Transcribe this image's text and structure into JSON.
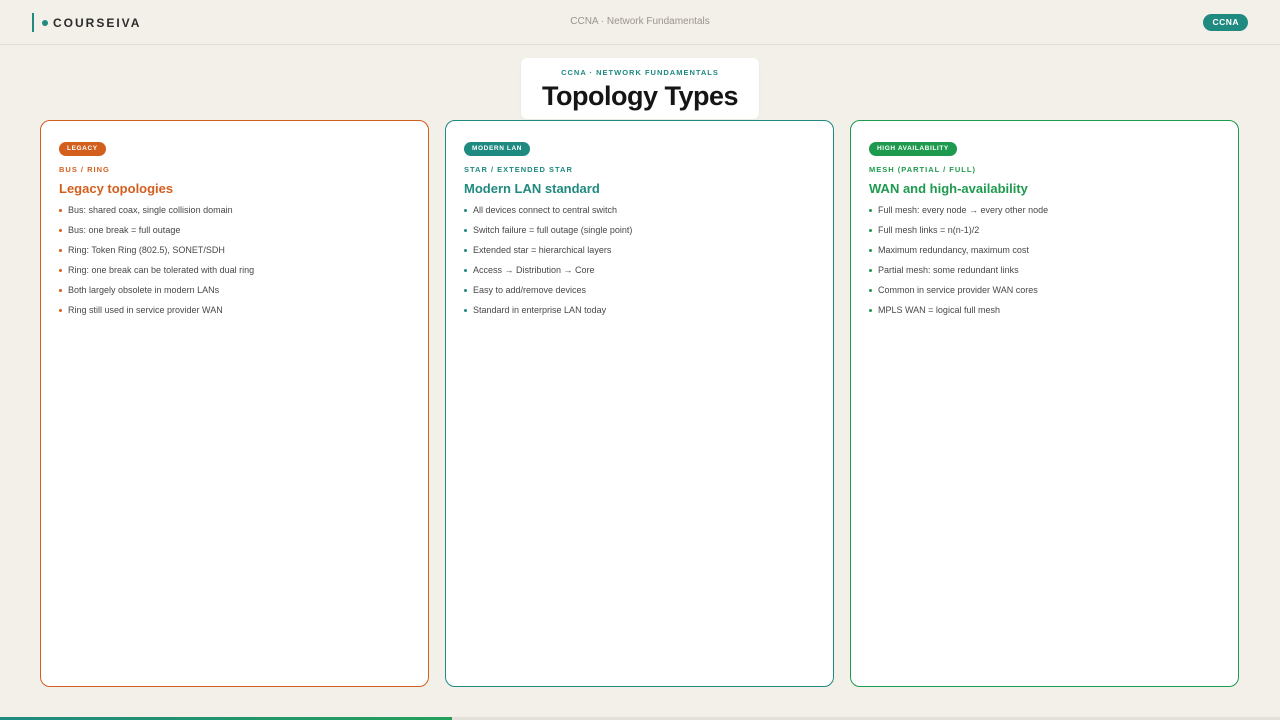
{
  "header": {
    "brand": "COURSEIVA",
    "title": "CCNA · Network Fundamentals",
    "badge": "CCNA"
  },
  "slide": {
    "kicker": "CCNA · NETWORK FUNDAMENTALS",
    "title": "Topology Types"
  },
  "cards": [
    {
      "tag": "LEGACY",
      "subtitle": "BUS / RING",
      "heading": "Legacy topologies",
      "color": "#d35f1f",
      "items": [
        "Bus: shared coax, single collision domain",
        "Bus: one break = full outage",
        "Ring: Token Ring (802.5), SONET/SDH",
        "Ring: one break can be tolerated with dual ring",
        "Both largely obsolete in modern LANs",
        "Ring still used in service provider WAN"
      ]
    },
    {
      "tag": "MODERN LAN",
      "subtitle": "STAR / EXTENDED STAR",
      "heading": "Modern LAN standard",
      "color": "#1f8a80",
      "items": [
        "All devices connect to central switch",
        "Switch failure = full outage (single point)",
        "Extended star = hierarchical layers",
        "Access → Distribution → Core",
        "Easy to add/remove devices",
        "Standard in enterprise LAN today"
      ]
    },
    {
      "tag": "HIGH AVAILABILITY",
      "subtitle": "MESH (PARTIAL / FULL)",
      "heading": "WAN and high-availability",
      "color": "#1e9a4e",
      "items": [
        "Full mesh: every node → every other node",
        "Full mesh links = n(n-1)/2",
        "Maximum redundancy, maximum cost",
        "Partial mesh: some redundant links",
        "Common in service provider WAN cores",
        "MPLS WAN = logical full mesh"
      ]
    }
  ],
  "progress": 0.353,
  "accent": "#1f8a80"
}
